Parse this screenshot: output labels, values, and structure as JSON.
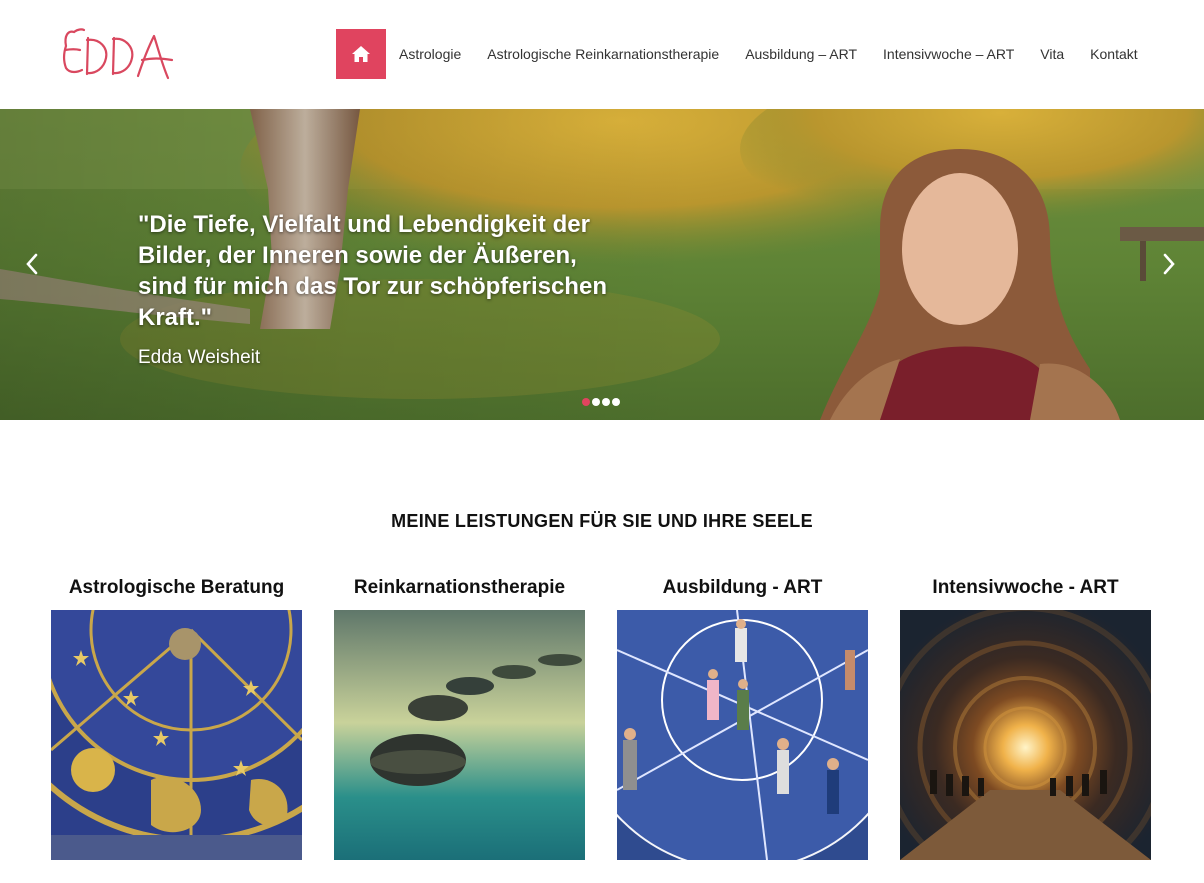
{
  "header": {
    "logo_text": "EDDA",
    "nav": {
      "home_icon": "home-icon",
      "items": [
        {
          "label": "Astrologie"
        },
        {
          "label": "Astrologische Reinkarnationstherapie"
        },
        {
          "label": "Ausbildung – ART"
        },
        {
          "label": "Intensivwoche – ART"
        },
        {
          "label": "Vita"
        },
        {
          "label": "Kontakt"
        }
      ]
    }
  },
  "hero": {
    "quote": "\"Die Tiefe, Vielfalt und Lebendigkeit der Bilder, der Inneren sowie der Äußeren, sind für mich das Tor zur schöpferischen Kraft.\"",
    "author": "Edda Weisheit",
    "prev_icon": "chevron-left-icon",
    "next_icon": "chevron-right-icon",
    "slides_count": 4,
    "active_slide": 1
  },
  "services": {
    "title": "MEINE LEISTUNGEN FÜR SIE UND IHRE SEELE",
    "cards": [
      {
        "title": "Astrologische Beratung"
      },
      {
        "title": "Reinkarnationstherapie"
      },
      {
        "title": "Ausbildung - ART"
      },
      {
        "title": "Intensivwoche - ART"
      }
    ]
  },
  "colors": {
    "accent": "#e0445f",
    "text": "#333333",
    "white": "#ffffff"
  }
}
